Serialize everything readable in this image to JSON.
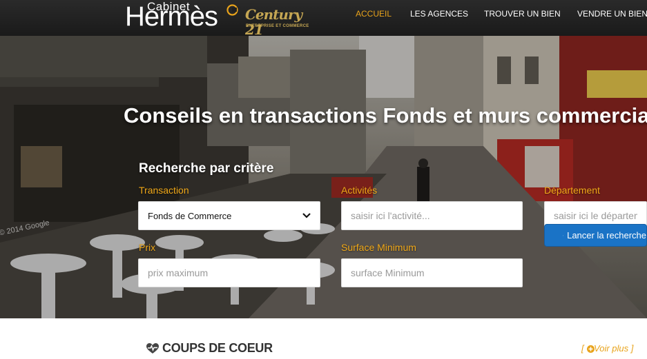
{
  "header": {
    "logo": {
      "line1": "Cabinet",
      "line2": "Hermès",
      "brand2_name": "Century 21",
      "brand2_tagline": "ENTREPRISE ET COMMERCE"
    },
    "nav": [
      {
        "label": "ACCUEIL",
        "active": true
      },
      {
        "label": "LES AGENCES",
        "active": false
      },
      {
        "label": "TROUVER UN BIEN",
        "active": false
      },
      {
        "label": "VENDRE UN BIEN",
        "active": false
      }
    ]
  },
  "hero": {
    "title": "Conseils en transactions Fonds et murs commerciaux",
    "search_title": "Recherche par critère",
    "fields": {
      "transaction": {
        "label": "Transaction",
        "value": "Fonds de Commerce"
      },
      "activites": {
        "label": "Activités",
        "placeholder": "saisir ici l'activité..."
      },
      "departement": {
        "label": "Département",
        "placeholder": "saisir ici le département"
      },
      "prix": {
        "label": "Prix",
        "placeholder": "prix maximum"
      },
      "surface": {
        "label": "Surface Minimum",
        "placeholder": "surface Minimum"
      }
    },
    "search_button": "Lancer la recherche",
    "watermark": "© 2014 Google"
  },
  "coups": {
    "title": "COUPS DE COEUR",
    "voir_plus": "[ Voir plus ]"
  },
  "colors": {
    "accent": "#e8a31b",
    "header_bg": "#1f1f1f",
    "button_blue": "#1a73c6"
  },
  "icons": {
    "chevron": "chevron-down-icon",
    "search": "search-icon",
    "heart": "heart-pulse-icon",
    "plus": "plus-circle-icon"
  }
}
